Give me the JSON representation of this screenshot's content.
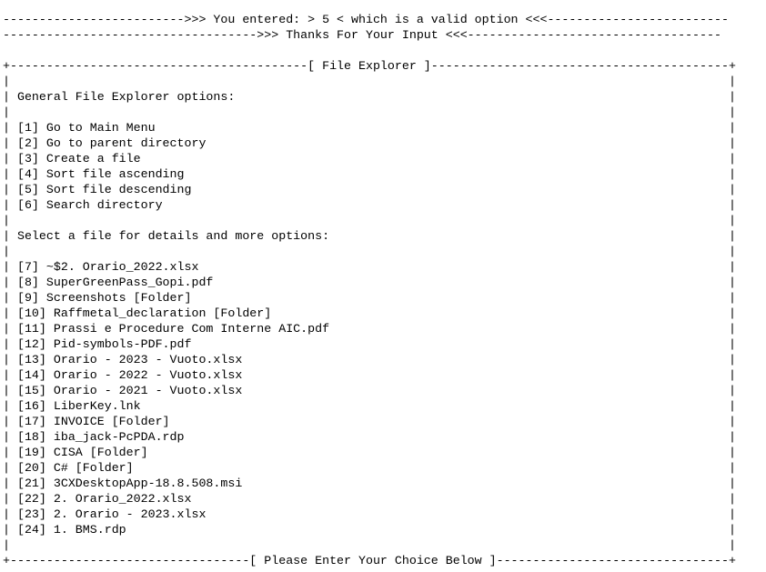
{
  "console": {
    "banner_entered": "------------------------->>> You entered: > 5 < which is a valid option <<<-------------------------",
    "banner_thanks": "----------------------------------->>> Thanks For Your Input <<<-----------------------------------",
    "box_top": "+-----------------------------------------[ File Explorer ]-----------------------------------------+",
    "box_bottom": "+---------------------------------[ Please Enter Your Choice Below ]--------------------------------+",
    "border_char": "|",
    "general_header": "General File Explorer options:",
    "options": [
      "[1] Go to Main Menu",
      "[2] Go to parent directory",
      "[3] Create a file",
      "[4] Sort file ascending",
      "[5] Sort file descending",
      "[6] Search directory"
    ],
    "select_header": "Select a file for details and more options:",
    "files": [
      "[7] ~$2. Orario_2022.xlsx",
      "[8] SuperGreenPass_Gopi.pdf",
      "[9] Screenshots [Folder]",
      "[10] Raffmetal_declaration [Folder]",
      "[11] Prassi e Procedure Com Interne AIC.pdf",
      "[12] Pid-symbols-PDF.pdf",
      "[13] Orario - 2023 - Vuoto.xlsx",
      "[14] Orario - 2022 - Vuoto.xlsx",
      "[15] Orario - 2021 - Vuoto.xlsx",
      "[16] LiberKey.lnk",
      "[17] INVOICE [Folder]",
      "[18] iba_jack-PcPDA.rdp",
      "[19] CISA [Folder]",
      "[20] C# [Folder]",
      "[21] 3CXDesktopApp-18.8.508.msi",
      "[22] 2. Orario_2022.xlsx",
      "[23] 2. Orario - 2023.xlsx",
      "[24] 1. BMS.rdp"
    ]
  }
}
